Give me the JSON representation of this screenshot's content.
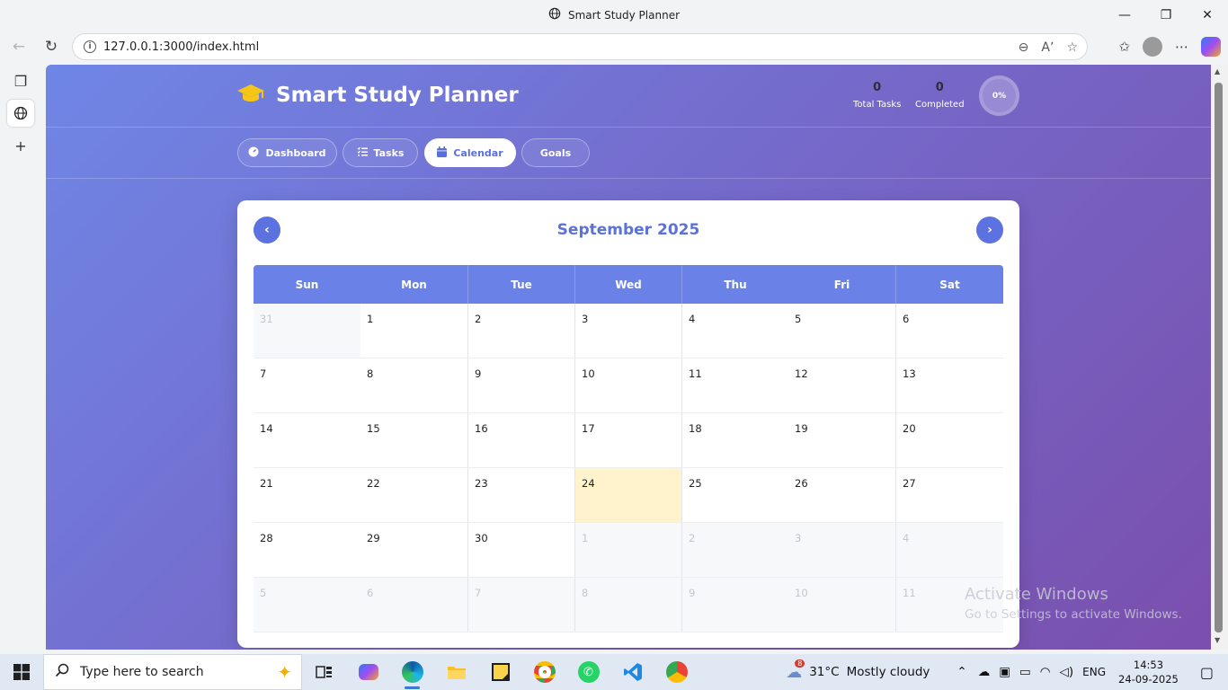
{
  "browser": {
    "window_title": "Smart Study Planner",
    "url": "127.0.0.1:3000/index.html"
  },
  "app": {
    "name": "Smart Study Planner",
    "stats": {
      "total_tasks_value": "0",
      "total_tasks_label": "Total Tasks",
      "completed_value": "0",
      "completed_label": "Completed",
      "progress_text": "0%",
      "progress_fraction": 0
    },
    "tabs": [
      {
        "label": "Dashboard",
        "icon": "gauge-icon",
        "active": false
      },
      {
        "label": "Tasks",
        "icon": "list-check-icon",
        "active": false
      },
      {
        "label": "Calendar",
        "icon": "calendar-icon",
        "active": true
      },
      {
        "label": "Goals",
        "icon": "target-icon",
        "active": false
      }
    ]
  },
  "calendar": {
    "month_title": "September 2025",
    "prev_label": "‹",
    "next_label": "›",
    "weekdays": [
      "Sun",
      "Mon",
      "Tue",
      "Wed",
      "Thu",
      "Fri",
      "Sat"
    ],
    "weeks": [
      [
        {
          "d": "31",
          "other": true
        },
        {
          "d": "1"
        },
        {
          "d": "2"
        },
        {
          "d": "3"
        },
        {
          "d": "4"
        },
        {
          "d": "5"
        },
        {
          "d": "6"
        }
      ],
      [
        {
          "d": "7"
        },
        {
          "d": "8"
        },
        {
          "d": "9"
        },
        {
          "d": "10"
        },
        {
          "d": "11"
        },
        {
          "d": "12"
        },
        {
          "d": "13"
        }
      ],
      [
        {
          "d": "14"
        },
        {
          "d": "15"
        },
        {
          "d": "16"
        },
        {
          "d": "17"
        },
        {
          "d": "18"
        },
        {
          "d": "19"
        },
        {
          "d": "20"
        }
      ],
      [
        {
          "d": "21"
        },
        {
          "d": "22"
        },
        {
          "d": "23"
        },
        {
          "d": "24",
          "today": true
        },
        {
          "d": "25"
        },
        {
          "d": "26"
        },
        {
          "d": "27"
        }
      ],
      [
        {
          "d": "28"
        },
        {
          "d": "29"
        },
        {
          "d": "30"
        },
        {
          "d": "1",
          "other": true
        },
        {
          "d": "2",
          "other": true
        },
        {
          "d": "3",
          "other": true
        },
        {
          "d": "4",
          "other": true
        }
      ],
      [
        {
          "d": "5",
          "other": true
        },
        {
          "d": "6",
          "other": true
        },
        {
          "d": "7",
          "other": true
        },
        {
          "d": "8",
          "other": true
        },
        {
          "d": "9",
          "other": true
        },
        {
          "d": "10",
          "other": true
        },
        {
          "d": "11",
          "other": true
        }
      ]
    ]
  },
  "watermark": {
    "line1": "Activate Windows",
    "line2": "Go to Settings to activate Windows."
  },
  "taskbar": {
    "search_placeholder": "Type here to search",
    "weather_temp": "31°C",
    "weather_desc": "Mostly cloudy",
    "weather_badge": "8",
    "language": "ENG",
    "time": "14:53",
    "date": "24-09-2025"
  },
  "colors": {
    "accent": "#5b72e0",
    "header_row": "#6a82e8",
    "today": "#fff3cd",
    "gradient_start": "#6f86e6",
    "gradient_end": "#7a4fad"
  }
}
